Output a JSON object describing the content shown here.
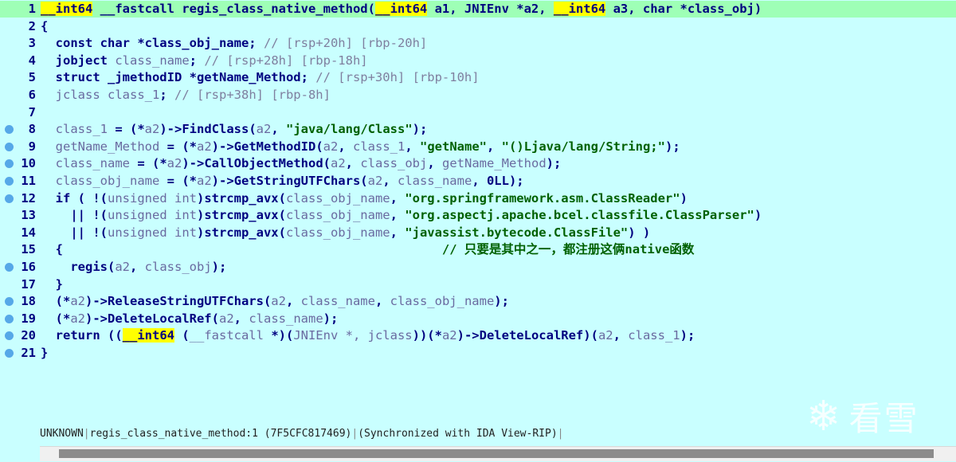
{
  "lines": [
    {
      "n": "1",
      "dot": false,
      "current": true,
      "html": "<span class=\"hl\">__int64</span> __fastcall regis_class_native_method(<span class=\"hl\">__int64</span> a1, JNIEnv *a2, <span class=\"hl\">__int64</span> a3, char *class_obj)"
    },
    {
      "n": "2",
      "dot": false,
      "html": "{"
    },
    {
      "n": "3",
      "dot": false,
      "html": "  const char *class_obj_name; <span class=\"cmt\">// [rsp+20h] [rbp-20h]</span>"
    },
    {
      "n": "4",
      "dot": false,
      "html": "  jobject <span class=\"var\">class_name</span>; <span class=\"cmt\">// [rsp+28h] [rbp-18h]</span>"
    },
    {
      "n": "5",
      "dot": false,
      "html": "  struct _jmethodID *getName_Method; <span class=\"cmt\">// [rsp+30h] [rbp-10h]</span>"
    },
    {
      "n": "6",
      "dot": false,
      "html": "  <span class=\"var\">jclass class_1</span>; <span class=\"cmt\">// [rsp+38h] [rbp-8h]</span>"
    },
    {
      "n": "7",
      "dot": false,
      "html": ""
    },
    {
      "n": "8",
      "dot": true,
      "html": "  <span class=\"var\">class_1</span> = (*<span class=\"var\">a2</span>)->FindClass(<span class=\"var\">a2</span>, <span class=\"str\">\"java/lang/Class\"</span>);"
    },
    {
      "n": "9",
      "dot": true,
      "html": "  <span class=\"var\">getName_Method</span> = (*<span class=\"var\">a2</span>)->GetMethodID(<span class=\"var\">a2</span>, <span class=\"var\">class_1</span>, <span class=\"str\">\"getName\"</span>, <span class=\"str\">\"()Ljava/lang/String;\"</span>);"
    },
    {
      "n": "10",
      "dot": true,
      "html": "  <span class=\"var\">class_name</span> = (*<span class=\"var\">a2</span>)->CallObjectMethod(<span class=\"var\">a2</span>, <span class=\"var\">class_obj</span>, <span class=\"var\">getName_Method</span>);"
    },
    {
      "n": "11",
      "dot": true,
      "html": "  <span class=\"var\">class_obj_name</span> = (*<span class=\"var\">a2</span>)->GetStringUTFChars(<span class=\"var\">a2</span>, <span class=\"var\">class_name</span>, 0LL);"
    },
    {
      "n": "12",
      "dot": true,
      "html": "  if ( !(<span class=\"var\">unsigned int</span>)strcmp_avx(<span class=\"var\">class_obj_name</span>, <span class=\"str\">\"org.springframework.asm.ClassReader\"</span>)"
    },
    {
      "n": "13",
      "dot": false,
      "html": "    || !(<span class=\"var\">unsigned int</span>)strcmp_avx(<span class=\"var\">class_obj_name</span>, <span class=\"str\">\"org.aspectj.apache.bcel.classfile.ClassParser\"</span>)"
    },
    {
      "n": "14",
      "dot": false,
      "html": "    || !(<span class=\"var\">unsigned int</span>)strcmp_avx(<span class=\"var\">class_obj_name</span>, <span class=\"str\">\"javassist.bytecode.ClassFile\"</span>) )"
    },
    {
      "n": "15",
      "dot": false,
      "html": "  {                                                   <span class=\"str\">// 只要是其中之一，都注册这俩native函数</span>"
    },
    {
      "n": "16",
      "dot": true,
      "html": "    regis(<span class=\"var\">a2</span>, <span class=\"var\">class_obj</span>);"
    },
    {
      "n": "17",
      "dot": false,
      "html": "  }"
    },
    {
      "n": "18",
      "dot": true,
      "html": "  (*<span class=\"var\">a2</span>)->ReleaseStringUTFChars(<span class=\"var\">a2</span>, <span class=\"var\">class_name</span>, <span class=\"var\">class_obj_name</span>);"
    },
    {
      "n": "19",
      "dot": true,
      "html": "  (*<span class=\"var\">a2</span>)->DeleteLocalRef(<span class=\"var\">a2</span>, <span class=\"var\">class_name</span>);"
    },
    {
      "n": "20",
      "dot": true,
      "html": "  return ((<span class=\"hl\">__int64</span> (<span class=\"var\">__fastcall</span> *)(<span class=\"var\">JNIEnv *, jclass</span>))(*<span class=\"var\">a2</span>)->DeleteLocalRef)(<span class=\"var\">a2</span>, <span class=\"var\">class_1</span>);"
    },
    {
      "n": "21",
      "dot": true,
      "html": "}"
    }
  ],
  "status": {
    "kind": "UNKNOWN",
    "location": "regis_class_native_method:1 (7F5CFC817469)",
    "sync": "(Synchronized with IDA View-RIP)"
  },
  "watermark": {
    "text": "看雪",
    "icon": "snowflake-icon"
  }
}
